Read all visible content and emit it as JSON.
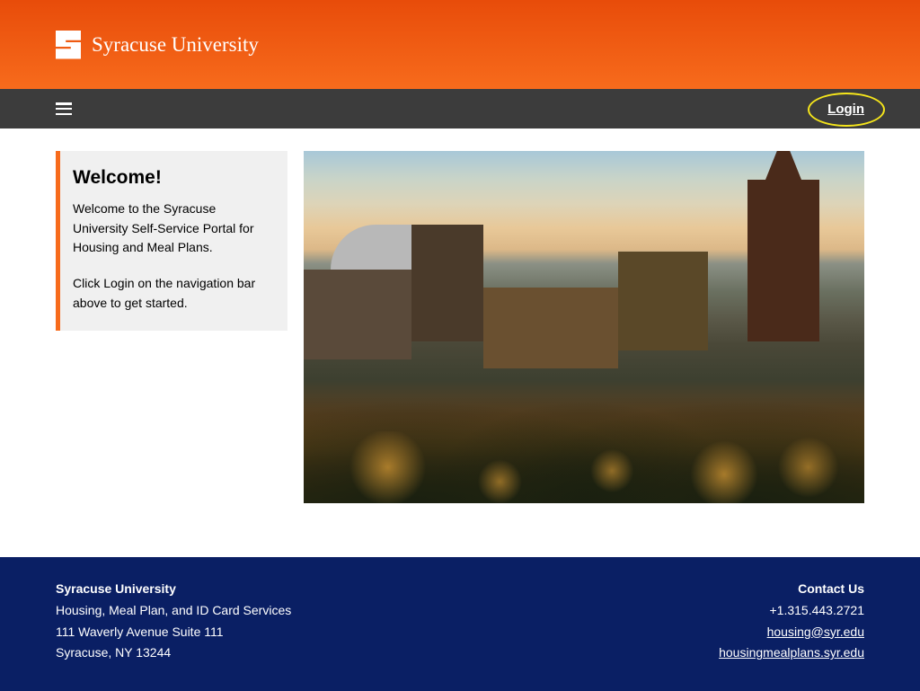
{
  "header": {
    "logo_text": "Syracuse University"
  },
  "navbar": {
    "login_label": "Login"
  },
  "welcome": {
    "heading": "Welcome!",
    "paragraph1": "Welcome to the Syracuse University Self-Service Portal for Housing and Meal Plans.",
    "paragraph2": "Click Login on the navigation bar above to get started."
  },
  "footer": {
    "org_name": "Syracuse University",
    "dept": "Housing, Meal Plan, and ID Card Services",
    "address1": "111 Waverly Avenue Suite 111",
    "address2": "Syracuse, NY 13244",
    "contact_title": "Contact Us",
    "phone": "+1.315.443.2721",
    "email": "housing@syr.edu",
    "website": "housingmealplans.syr.edu"
  }
}
